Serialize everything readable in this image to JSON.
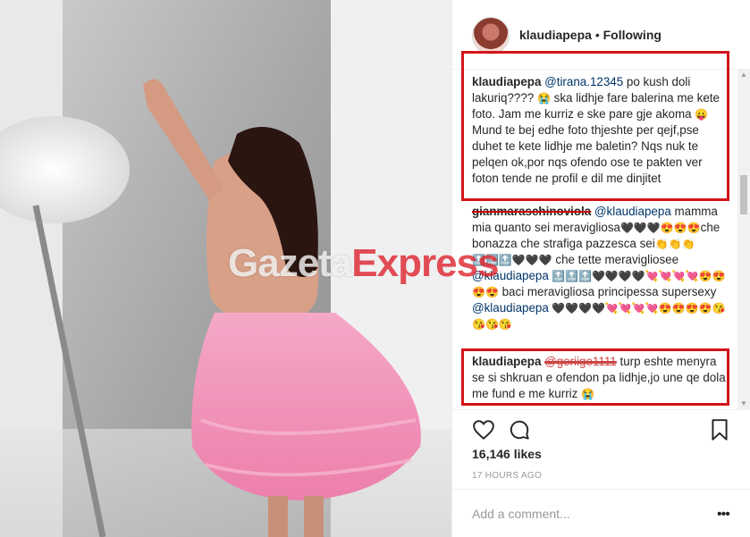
{
  "post": {
    "username": "klaudiapepa",
    "separator": "•",
    "follow_status": "Following"
  },
  "comments": [
    {
      "username": "klaudiapepa",
      "mention": "@tirana.12345",
      "text1": "po kush doli lakuriq???? ",
      "emoji1": "😭",
      "text2": " ska lidhje fare balerina me kete foto. Jam me kurriz e ske pare gje akoma ",
      "emoji2": "😛",
      "text3": " Mund te bej edhe foto thjeshte per qejf,pse duhet te kete lidhje me baletin? Nqs nuk te pelqen ok,por nqs ofendo ose te pakten ver foton tende ne profil e dil me dinjitet"
    },
    {
      "username": "gianmaraschinoviola",
      "mention": "@klaudiapepa",
      "text1": "mamma mia quanto sei meravigliosa",
      "emoji1": "🖤🖤🖤😍😍😍",
      "text2": "che bonazza che strafiga pazzesca sei",
      "emoji2": "👏👏👏🔝🔝🔝🖤🖤🖤",
      "text3": " che tette meravigliosee ",
      "mention2": "@klaudiapepa",
      "emoji3": " 🔝🔝🔝🖤🖤🖤🖤💘💘💘💘😍😍😍😍",
      "text4": " baci meravigliosa principessa supersexy ",
      "mention3": "@klaudiapepa",
      "emoji4": " 🖤🖤🖤🖤💘💘💘💘😍😍😍😍😘😘😘😘"
    },
    {
      "username": "klaudiapepa",
      "mention": "@geriige1111",
      "text1": " turp eshte menyra se si shkruan e ofendon pa lidhje,jo une qe dola me fund e me kurriz ",
      "emoji1": "😭"
    }
  ],
  "likes": "16,146 likes",
  "timestamp": "17 HOURS AGO",
  "add_comment": {
    "placeholder": "Add a comment..."
  },
  "more_label": "•••",
  "watermark": {
    "part1": "Gazeta",
    "part2": "Express"
  },
  "colors": {
    "highlight": "#d4141b",
    "mention": "#003569",
    "skirt": "#f08db4"
  },
  "icons": [
    "heart-icon",
    "comment-icon",
    "bookmark-icon",
    "more-options-icon"
  ]
}
